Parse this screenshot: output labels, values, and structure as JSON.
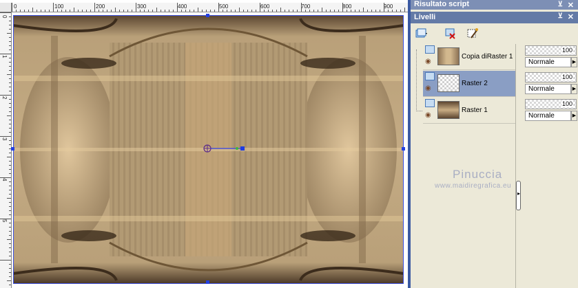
{
  "canvas": {
    "ruler_h_labels": [
      "0",
      "100",
      "200",
      "300",
      "400",
      "500",
      "600",
      "700",
      "800",
      "900"
    ],
    "ruler_v_labels": [
      "0",
      "1",
      "2",
      "3",
      "4",
      "5"
    ]
  },
  "panels": {
    "script_title": "Risultato script",
    "layers_title": "Livelli",
    "pin_icon": "pin-icon",
    "close_icon": "close-icon"
  },
  "layers": [
    {
      "name": "Copia diRaster 1",
      "opacity": "100",
      "blend": "Normale",
      "selected": false
    },
    {
      "name": "Raster 2",
      "opacity": "100",
      "blend": "Normale",
      "selected": true
    },
    {
      "name": "Raster 1",
      "opacity": "100",
      "blend": "Normale",
      "selected": false
    }
  ],
  "watermark": {
    "name": "Pinuccia",
    "url": "www.maidiregrafica.eu"
  },
  "colors": {
    "panel_header": "#647aa6",
    "selected_row": "#8a9ec4",
    "image_base": "#b39a72"
  }
}
